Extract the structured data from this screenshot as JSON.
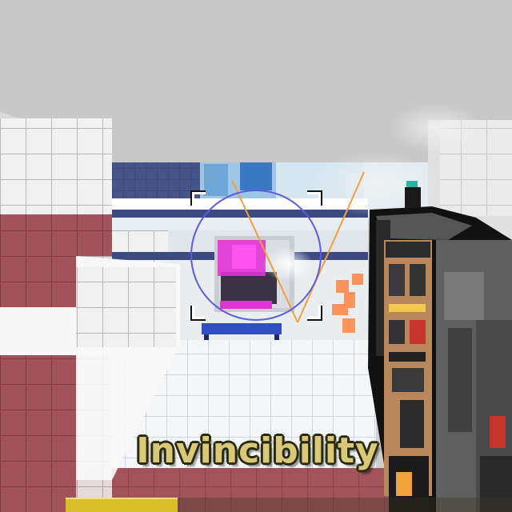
{
  "hud": {
    "powerup_label": "Invincibility",
    "powerup_remaining": 0.25,
    "powerup_bar_color": "#d9bd2a",
    "reticle_color": "#5a5ce0",
    "laser_color": "#f0a040"
  },
  "icons": {
    "crosshair": "crosshair-bracket-icon",
    "weapon": "blocky-minigun"
  }
}
